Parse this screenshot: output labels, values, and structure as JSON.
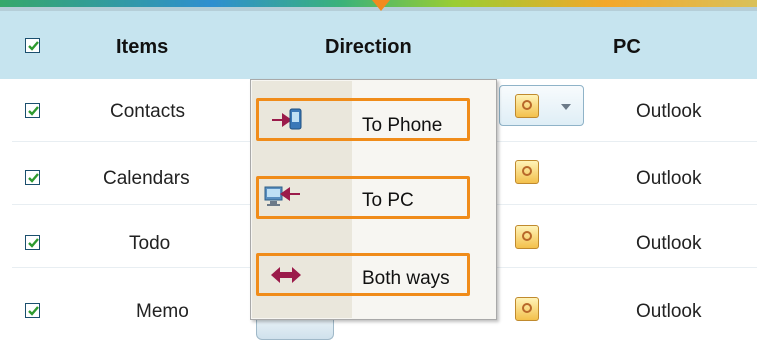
{
  "header": {
    "items_label": "Items",
    "direction_label": "Direction",
    "pc_label": "PC"
  },
  "rows": [
    {
      "item": "Contacts",
      "pc": "Outlook",
      "checked": true
    },
    {
      "item": "Calendars",
      "pc": "Outlook",
      "checked": true
    },
    {
      "item": "Todo",
      "pc": "Outlook",
      "checked": true
    },
    {
      "item": "Memo",
      "pc": "Outlook",
      "checked": true
    }
  ],
  "direction_menu": {
    "options": [
      {
        "label": "To Phone",
        "icon": "to-phone-icon"
      },
      {
        "label": "To PC",
        "icon": "to-pc-icon"
      },
      {
        "label": "Both ways",
        "icon": "both-ways-icon"
      }
    ]
  },
  "partial_text": "y",
  "colors": {
    "header_bg": "#c6e4ef",
    "highlight_border": "#f08c1a",
    "arrow": "#9b1b4a",
    "check": "#2e9a2e"
  }
}
